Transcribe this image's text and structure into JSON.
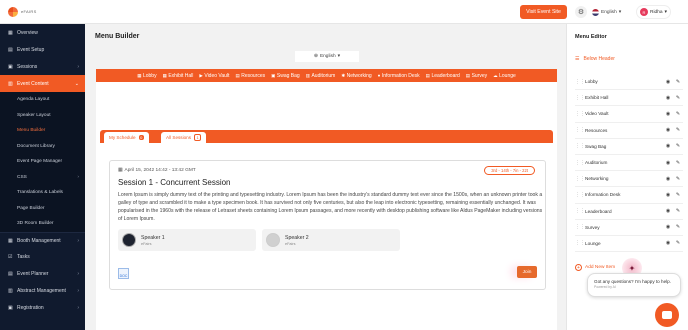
{
  "app": {
    "logo_text": "eFAIRS"
  },
  "topbar": {
    "visit_button": "Visit Event Site",
    "language": "English",
    "user_initial": "R",
    "user_name": "Ridha"
  },
  "sidebar": {
    "items": [
      {
        "label": "Overview"
      },
      {
        "label": "Event Setup"
      },
      {
        "label": "Sessions"
      },
      {
        "label": "Event Content"
      }
    ],
    "sub_items": [
      {
        "label": "Agenda Layout"
      },
      {
        "label": "Speaker Layout"
      },
      {
        "label": "Menu Builder"
      },
      {
        "label": "Document Library"
      },
      {
        "label": "Event Page Manager"
      },
      {
        "label": "CSS"
      },
      {
        "label": "Translations & Labels"
      },
      {
        "label": "Page Builder"
      },
      {
        "label": "3D Room Builder"
      }
    ],
    "bottom_items": [
      {
        "label": "Booth Management"
      },
      {
        "label": "Tasks"
      },
      {
        "label": "Event Planner"
      },
      {
        "label": "Abstract Management"
      },
      {
        "label": "Registration"
      }
    ]
  },
  "main": {
    "title": "Menu Builder",
    "language_select": "English",
    "menu_items": [
      "Lobby",
      "Exhibit Hall",
      "Video Vault",
      "Resources",
      "Swag Bag",
      "Auditorium",
      "Networking",
      "Information Desk",
      "Leaderboard",
      "Survey",
      "Lounge"
    ],
    "tabs": [
      {
        "label": "My Schedule",
        "count": "0"
      },
      {
        "label": "All Sessions",
        "count": "1"
      }
    ],
    "session": {
      "date": "April 15, 2042 14:42 - 13:42 GMT",
      "tag": "3rd - 14th - 7in - 22t",
      "title": "Session 1 - Concurrent Session",
      "description": "Lorem Ipsum is simply dummy text of the printing and typesetting industry. Lorem Ipsum has been the industry's standard dummy text ever since the 1500s, when an unknown printer took a galley of type and scrambled it to make a type specimen book. It has survived not only five centuries, but also the leap into electronic typesetting, remaining essentially unchanged. It was popularised in the 1960s with the release of Letraset sheets containing Lorem Ipsum passages, and more recently with desktop publishing software like Aldus PageMaker including versions of Lorem Ipsum.",
      "speakers": [
        {
          "name": "Speaker 1",
          "org": "eFairs"
        },
        {
          "name": "Speaker 2",
          "org": "eFairs"
        }
      ],
      "doc_label": "DOC",
      "join_label": "Join"
    }
  },
  "editor": {
    "title": "Menu Editor",
    "below_header": "Below Header",
    "rows": [
      "Lobby",
      "Exhibit Hall",
      "Video Vault",
      "Resources",
      "Swag Bag",
      "Auditorium",
      "Networking",
      "Information Desk",
      "Leaderboard",
      "Survey",
      "Lounge"
    ],
    "add_new": "Add New Item"
  },
  "chat": {
    "message": "Got any questions? I'm happy to help.",
    "powered": "Powered by AI"
  },
  "colors": {
    "accent": "#f15a24",
    "sidebar": "#101a2e"
  }
}
